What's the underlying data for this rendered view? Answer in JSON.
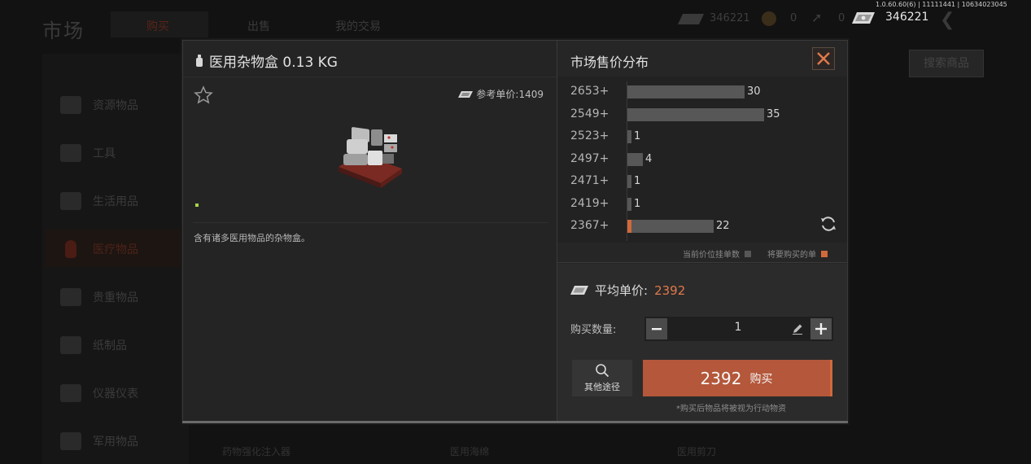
{
  "background": {
    "title": "市场",
    "tabs": [
      "购买",
      "出售",
      "我的交易"
    ],
    "sidebar": [
      "资源物品",
      "工具",
      "生活用品",
      "医疗物品",
      "贵重物品",
      "纸制品",
      "仪器仪表",
      "军用物品"
    ],
    "currency_left": "346221",
    "coin_value": "0",
    "arrow_value": "0",
    "search_button": "搜索商品",
    "bottom_items": [
      "药物强化注入器",
      "医用海绵",
      "医用剪刀"
    ]
  },
  "topbar": {
    "version": "1.0.60.60(6) | 11111441 | 10634023045",
    "money": "346221"
  },
  "item": {
    "name": "医用杂物盒 0.13 KG",
    "ref_price": "参考单价:1409",
    "description": "含有诸多医用物品的杂物盒。"
  },
  "distribution": {
    "title": "市场售价分布",
    "legend_current": "当前价位挂单数",
    "legend_buy": "将要购买的单",
    "colors": {
      "bar": "#575757",
      "buy": "#d06a3a"
    },
    "rows": [
      {
        "label": "2653+",
        "count": 30,
        "buy": 0
      },
      {
        "label": "2549+",
        "count": 35,
        "buy": 0
      },
      {
        "label": "2523+",
        "count": 1,
        "buy": 0
      },
      {
        "label": "2497+",
        "count": 4,
        "buy": 0
      },
      {
        "label": "2471+",
        "count": 1,
        "buy": 0
      },
      {
        "label": "2419+",
        "count": 1,
        "buy": 0
      },
      {
        "label": "2367+",
        "count": 22,
        "buy": 1
      }
    ]
  },
  "purchase": {
    "avg_label": "平均单价:",
    "avg_value": "2392",
    "qty_label": "购买数量:",
    "qty_value": "1",
    "qty_fraction": 0,
    "other_label": "其他途径",
    "buy_price": "2392",
    "buy_label": "购买",
    "note": "*购买后物品将被视为行动物资"
  },
  "icons": [
    "star-icon",
    "bottle-icon",
    "money-icon",
    "close-icon",
    "refresh-icon",
    "search-icon",
    "pencil-icon"
  ]
}
